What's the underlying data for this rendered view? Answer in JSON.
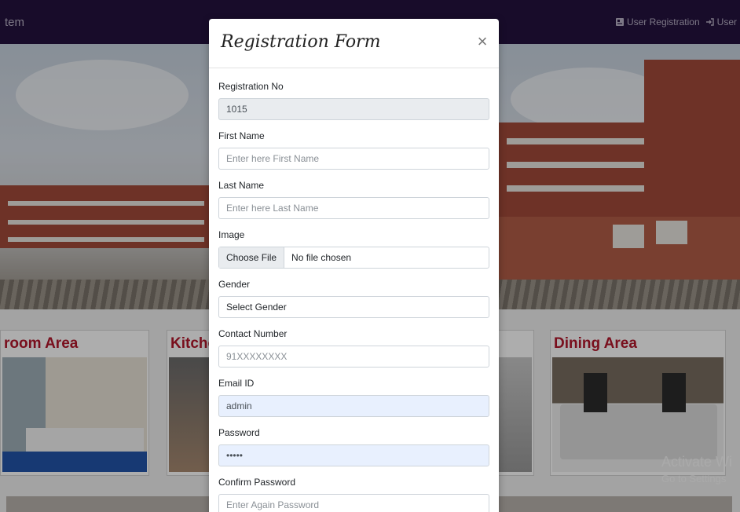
{
  "navbar": {
    "brand": "tem",
    "links": [
      {
        "label": "User Registration"
      },
      {
        "label": "User"
      }
    ]
  },
  "cards": [
    {
      "title": "room Area"
    },
    {
      "title": "Kitche"
    },
    {
      "title": "Dining Area"
    }
  ],
  "watermark": {
    "line1": "Activate Wi",
    "line2": "Go to Settings"
  },
  "modal": {
    "title": "Registration Form",
    "close_symbol": "×",
    "fields": {
      "registration_no": {
        "label": "Registration No",
        "value": "1015"
      },
      "first_name": {
        "label": "First Name",
        "placeholder": "Enter here First Name"
      },
      "last_name": {
        "label": "Last Name",
        "placeholder": "Enter here Last Name"
      },
      "image": {
        "label": "Image",
        "button": "Choose File",
        "status": "No file chosen"
      },
      "gender": {
        "label": "Gender",
        "selected": "Select Gender"
      },
      "contact": {
        "label": "Contact Number",
        "placeholder": "91XXXXXXXX"
      },
      "email": {
        "label": "Email ID",
        "value": "admin"
      },
      "password": {
        "label": "Password",
        "value": "•••••"
      },
      "confirm_password": {
        "label": "Confirm Password",
        "placeholder": "Enter Again Password"
      }
    }
  },
  "colors": {
    "navbar": "#24123f",
    "card_title": "#b3172b",
    "autofill": "#e8f0fe"
  }
}
